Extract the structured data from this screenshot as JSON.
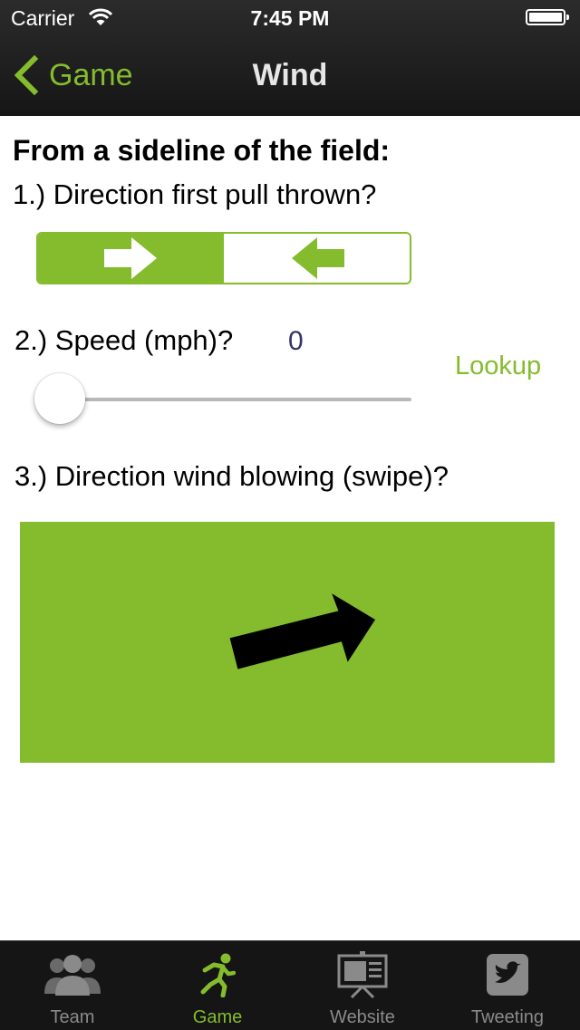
{
  "status_bar": {
    "carrier": "Carrier",
    "time": "7:45 PM"
  },
  "nav": {
    "back_label": "Game",
    "title": "Wind"
  },
  "content": {
    "heading": "From a sideline of the field:",
    "question1": "1.) Direction first pull thrown?",
    "pull_direction": {
      "options": [
        "right",
        "left"
      ],
      "selected": "right"
    },
    "question2": "2.) Speed (mph)?",
    "speed_value": "0",
    "lookup_label": "Lookup",
    "speed_slider": {
      "value": 0
    },
    "question3": "3.) Direction wind blowing (swipe)?"
  },
  "tabs": [
    {
      "label": "Team",
      "icon": "team-icon",
      "active": false
    },
    {
      "label": "Game",
      "icon": "runner-icon",
      "active": true
    },
    {
      "label": "Website",
      "icon": "website-icon",
      "active": false
    },
    {
      "label": "Tweeting",
      "icon": "twitter-icon",
      "active": false
    }
  ],
  "colors": {
    "accent": "#84bc2d",
    "bar_dark": "#151515",
    "speed_value": "#333366"
  }
}
